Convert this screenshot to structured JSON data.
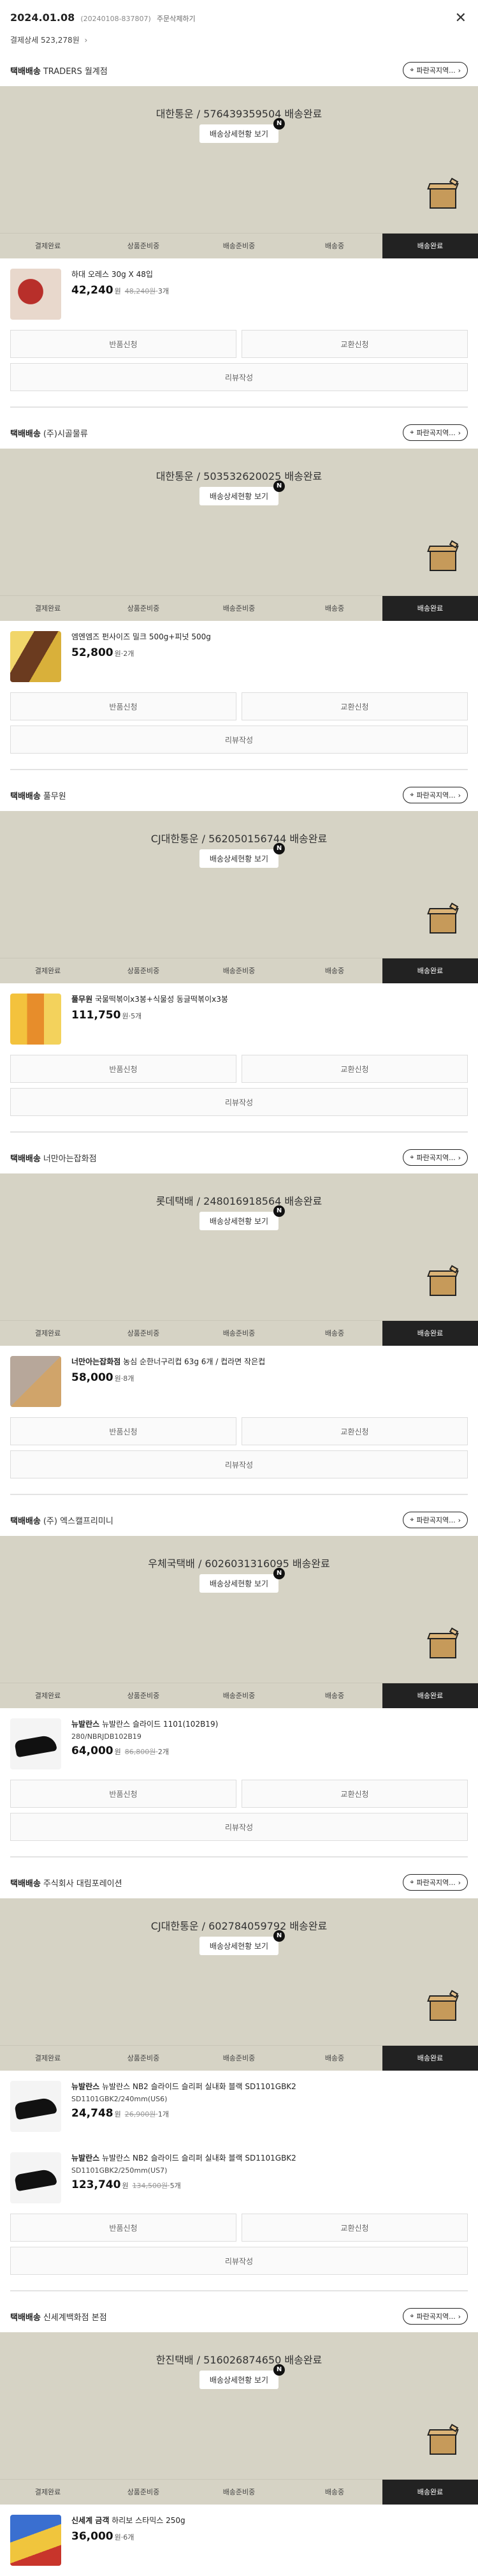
{
  "order": {
    "date": "2024.01.08",
    "order_no": "(20240108-837807)",
    "delete_label": "주문삭제하기",
    "payment_label": "결제상세",
    "payment_amount": "523,278원"
  },
  "labels": {
    "track_label": "배송상세현황 보기",
    "location_label": "파란곡지역...",
    "return_label": "반품신청",
    "exchange_label": "교환신청",
    "review_label": "리뷰작성",
    "currency": "원",
    "separator": "·",
    "steps": [
      "결제완료",
      "상품준비중",
      "배송준비중",
      "배송중",
      "배송완료"
    ]
  },
  "shipments": [
    {
      "kind": "택배배송",
      "seller": "TRADERS 월계점",
      "carrier": "대한통운 / 576439359504 배송완료",
      "items": [
        {
          "brand": "",
          "name": "하대 오레스 30g X 48입",
          "option": "",
          "price": "42,240",
          "orig": "48,240원",
          "qty": "3개"
        }
      ],
      "review": true
    },
    {
      "kind": "택배배송",
      "seller": "(주)시골물류",
      "carrier": "대한통운 / 503532620025 배송완료",
      "items": [
        {
          "brand": "",
          "name": "엠엔엠즈 펀사이즈 밀크 500g+피넛 500g",
          "option": "",
          "price": "52,800",
          "orig": "",
          "qty": "2개"
        }
      ],
      "review": true
    },
    {
      "kind": "택배배송",
      "seller": "풀무원",
      "carrier": "CJ대한통운 / 562050156744 배송완료",
      "items": [
        {
          "brand": "풀무원",
          "name": "국물떡볶이x3봉+식물성 동글떡볶이x3봉",
          "option": "",
          "price": "111,750",
          "orig": "",
          "qty": "5개"
        }
      ],
      "review": true
    },
    {
      "kind": "택배배송",
      "seller": "너만아는잡화점",
      "carrier": "롯데택배 / 248016918564 배송완료",
      "items": [
        {
          "brand": "너만아는잡화점",
          "name": "농심 순한너구리컵 63g 6개 / 컵라면 작은컵",
          "option": "",
          "price": "58,000",
          "orig": "",
          "qty": "8개"
        }
      ],
      "review": true
    },
    {
      "kind": "택배배송",
      "seller": "(주) 엑스캘프리미니",
      "carrier": "우체국택배 / 6026031316095 배송완료",
      "items": [
        {
          "brand": "뉴발란스",
          "name": "뉴발란스 슬라이드 1101(102B19)",
          "option": "280/NBRJDB102B19",
          "price": "64,000",
          "orig": "86,800원",
          "qty": "2개"
        }
      ],
      "review": true
    },
    {
      "kind": "택배배송",
      "seller": "주식회사 대림포레이션",
      "carrier": "CJ대한통운 / 602784059792 배송완료",
      "items": [
        {
          "brand": "뉴발란스",
          "name": "뉴발란스 NB2 슬라이드 슬리퍼 실내화 블랙 SD1101GBK2",
          "option": "SD1101GBK2/240mm(US6)",
          "price": "24,748",
          "orig": "26,900원",
          "qty": "1개"
        },
        {
          "brand": "뉴발란스",
          "name": "뉴발란스 NB2 슬라이드 슬리퍼 실내화 블랙 SD1101GBK2",
          "option": "SD1101GBK2/250mm(US7)",
          "price": "123,740",
          "orig": "134,500원",
          "qty": "5개"
        }
      ],
      "review": true
    },
    {
      "kind": "택배배송",
      "seller": "신세계백화점 본점",
      "carrier": "한진택배 / 516026874650 배송완료",
      "items": [
        {
          "brand": "신세계 금객",
          "name": "하리보 스타믹스 250g",
          "option": "",
          "price": "36,000",
          "orig": "",
          "qty": "6개"
        }
      ],
      "review": false
    }
  ]
}
